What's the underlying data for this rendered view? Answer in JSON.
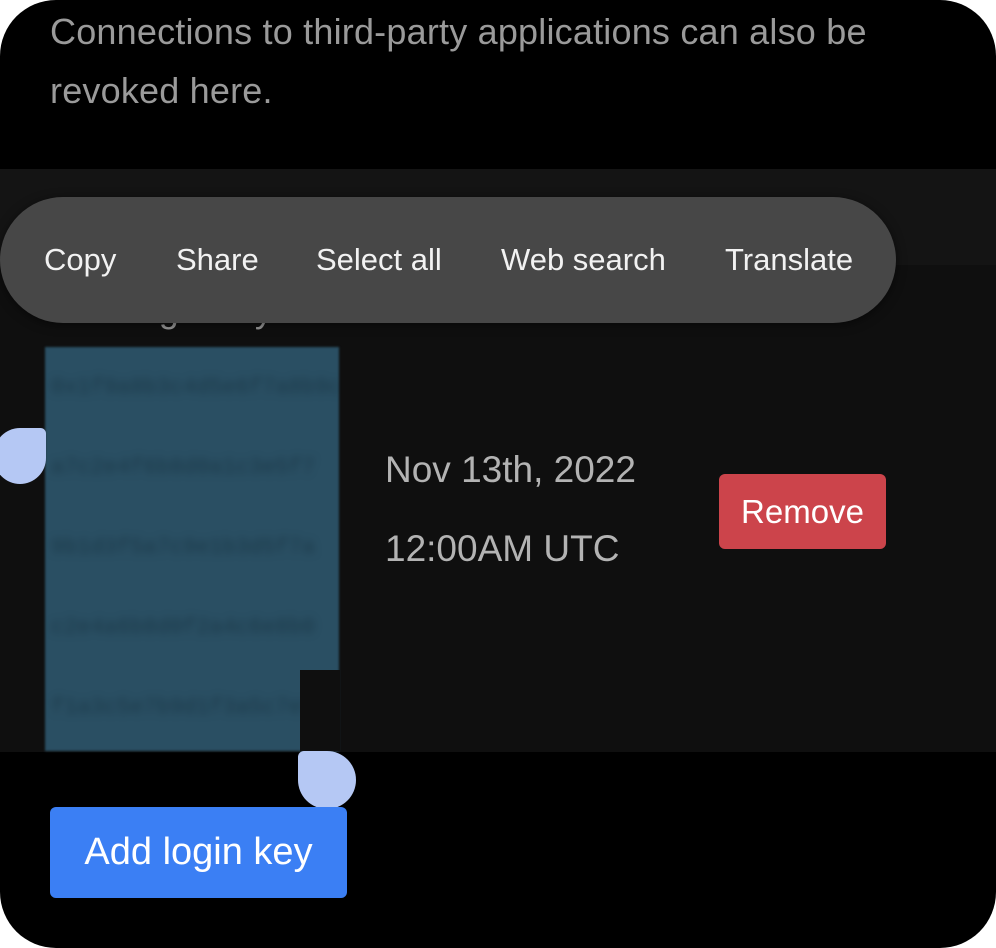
{
  "intro": {
    "text": "Connections to third-party applications can also be revoked here."
  },
  "clipped_heading": {
    "text": "Your login keys"
  },
  "login_key": {
    "blurred_lines": [
      "0x1f9a8b3c4d5e6f7a8b9c",
      "a7c2e4f6b8d0a1c3e5f7",
      "9b1d3f5a7c9e1b3d5f7a",
      "c2e4a6b8d0f2a4c6e8b0",
      "f1a3c5e7b9d1f3a5c7e9"
    ],
    "date": "Nov 13th, 2022",
    "time": "12:00AM UTC",
    "remove_label": "Remove"
  },
  "add_button": {
    "label": "Add login key"
  },
  "context_menu": {
    "items": [
      "Copy",
      "Share",
      "Select all",
      "Web search",
      "Translate"
    ]
  },
  "colors": {
    "background": "#000000",
    "panel": "#0f0f0f",
    "menu": "#474747",
    "selection": "#2a4f63",
    "handle": "#b5c8f4",
    "remove": "#cc444b",
    "primary": "#3b7ff4"
  }
}
